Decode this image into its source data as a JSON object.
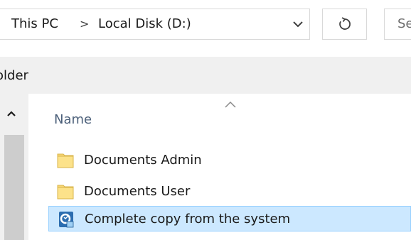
{
  "address_bar": {
    "crumbs": [
      "This PC",
      "Local Disk (D:)"
    ],
    "separator": ">",
    "dropdown_icon": "chevron-down-icon",
    "refresh_icon": "refresh-icon"
  },
  "search": {
    "placeholder": "Se"
  },
  "folder_label": "older",
  "file_list": {
    "column_header": "Name",
    "sort_icon": "sort-up-icon",
    "rows": [
      {
        "name": "Documents Admin",
        "icon": "folder-icon",
        "selected": false
      },
      {
        "name": "Documents User",
        "icon": "folder-icon",
        "selected": false
      },
      {
        "name": "Complete copy from the system",
        "icon": "system-image-icon",
        "selected": true
      }
    ]
  },
  "colors": {
    "selection_bg": "#cce8ff",
    "selection_border": "#99d1ff",
    "header_text": "#4c607a",
    "folder_yellow": "#f8d775"
  }
}
